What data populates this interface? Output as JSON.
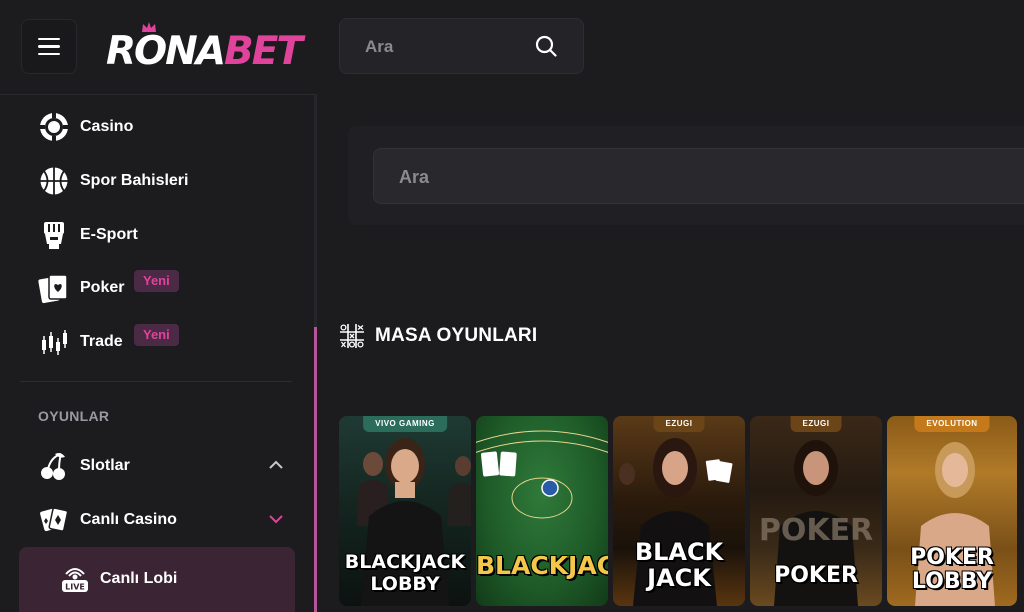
{
  "header": {
    "logo_part1": "RONA",
    "logo_part2": "BET",
    "search_placeholder": "Ara"
  },
  "sidebar": {
    "items": [
      {
        "label": "Casino",
        "icon": "casino-chip-icon"
      },
      {
        "label": "Spor Bahisleri",
        "icon": "basketball-icon"
      },
      {
        "label": "E-Sport",
        "icon": "esport-fist-icon"
      },
      {
        "label": "Poker",
        "icon": "poker-cards-icon",
        "badge": "Yeni"
      },
      {
        "label": "Trade",
        "icon": "candlestick-chart-icon",
        "badge": "Yeni"
      }
    ],
    "section_title": "OYUNLAR",
    "game_items": [
      {
        "label": "Slotlar",
        "icon": "cherries-icon",
        "expanded": true
      },
      {
        "label": "Canlı Casino",
        "icon": "playing-cards-icon",
        "expanded": false
      }
    ],
    "active_item": {
      "label": "Canlı Lobi",
      "icon": "live-broadcast-icon"
    }
  },
  "main": {
    "search_placeholder": "Ara",
    "section_title": "MASA OYUNLARI",
    "section_icon": "tic-tac-toe-icon",
    "games": [
      {
        "provider": "VIVO GAMING",
        "title_line1": "BLACKJACK",
        "title_line2": "LOBBY"
      },
      {
        "provider": "",
        "title_line1": "BLACKJAC",
        "title_line2": ""
      },
      {
        "provider": "EZUGI",
        "title_line1": "BLACK",
        "title_line2": "JACK"
      },
      {
        "provider": "EZUGI",
        "title_line1": "POKER",
        "title_line2": ""
      },
      {
        "provider": "EVOLUTION",
        "title_line1": "POKER",
        "title_line2": "LOBBY"
      }
    ]
  },
  "colors": {
    "background": "#1c1b1e",
    "accent_pink": "#e0439b",
    "badge_bg": "#4a2a45",
    "active_bg": "#3b2534"
  }
}
